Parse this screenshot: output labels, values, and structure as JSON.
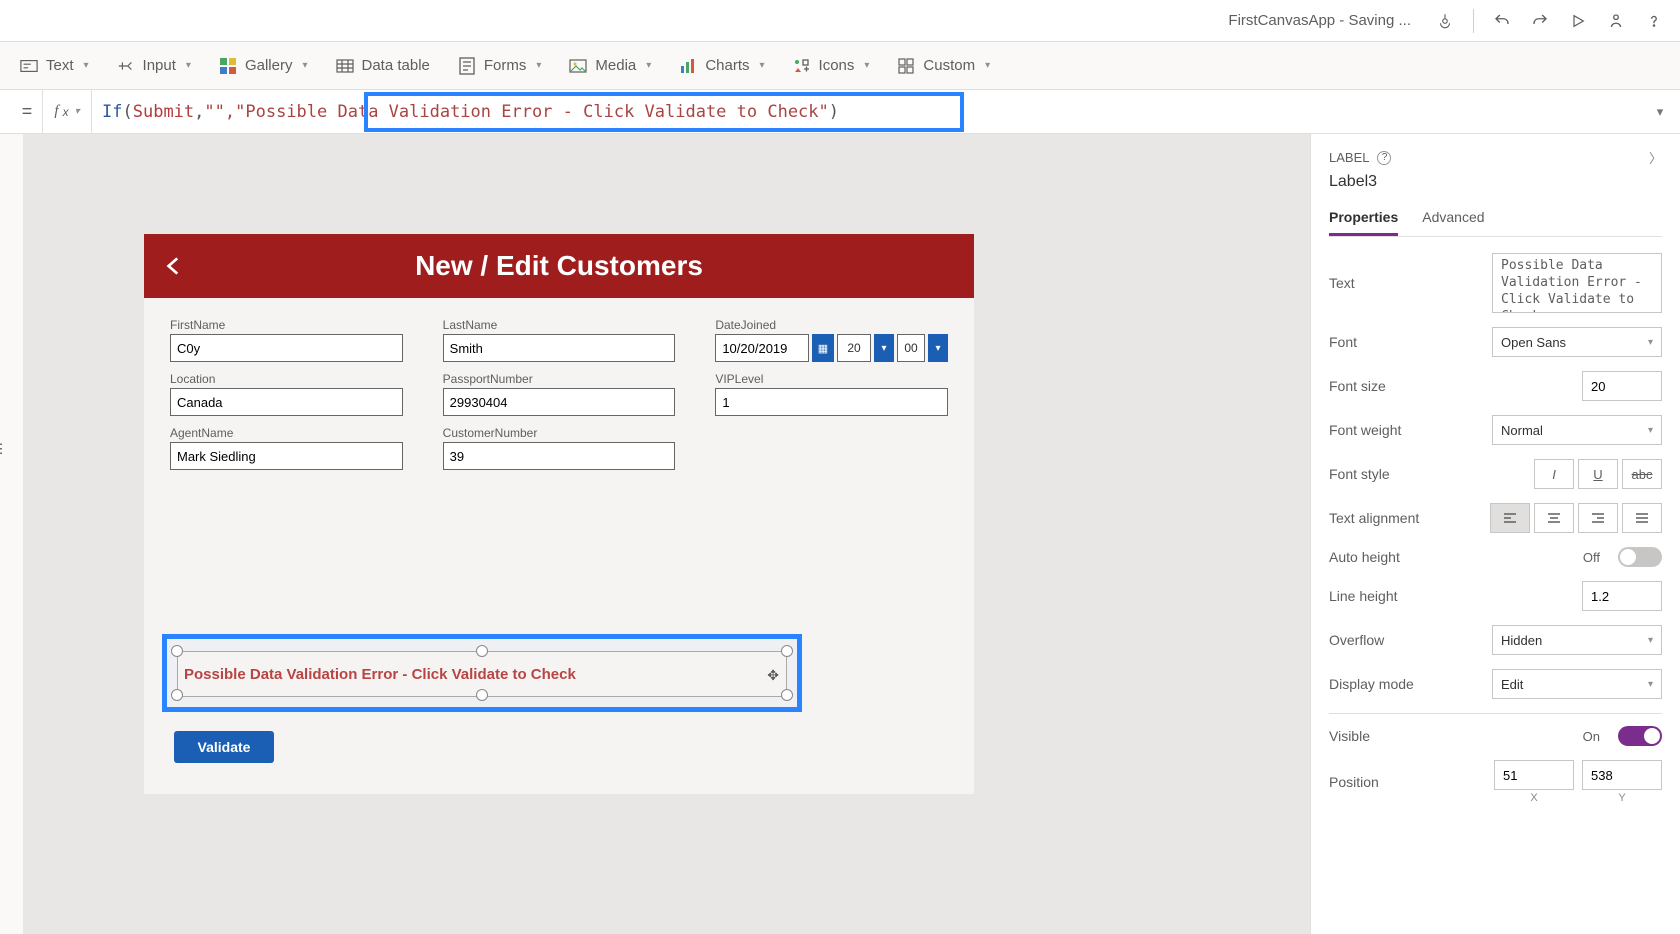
{
  "titlebar": {
    "app_title": "FirstCanvasApp - Saving ..."
  },
  "ribbon": {
    "text": "Text",
    "input": "Input",
    "gallery": "Gallery",
    "data_table": "Data table",
    "forms": "Forms",
    "media": "Media",
    "charts": "Charts",
    "icons": "Icons",
    "custom": "Custom"
  },
  "formula": {
    "fn": "If",
    "arg1": "Submit",
    "arg2": "\"\"",
    "arg3": "\"Possible Data Validation Error - Click Validate to Check\""
  },
  "canvas": {
    "header_title": "New / Edit Customers",
    "fields": {
      "firstname_label": "FirstName",
      "firstname_value": "C0y",
      "lastname_label": "LastName",
      "lastname_value": "Smith",
      "datejoined_label": "DateJoined",
      "datejoined_value": "10/20/2019",
      "datejoined_hour": "20",
      "datejoined_min": "00",
      "location_label": "Location",
      "location_value": "Canada",
      "passport_label": "PassportNumber",
      "passport_value": "29930404",
      "vip_label": "VIPLevel",
      "vip_value": "1",
      "agent_label": "AgentName",
      "agent_value": "Mark Siedling",
      "custnum_label": "CustomerNumber",
      "custnum_value": "39"
    },
    "validation_text": "Possible Data Validation Error - Click Validate to Check",
    "validate_button": "Validate"
  },
  "props": {
    "header_type": "LABEL",
    "control_name": "Label3",
    "tab_properties": "Properties",
    "tab_advanced": "Advanced",
    "text_label": "Text",
    "text_value": "Possible Data Validation Error - Click Validate to Check",
    "font_label": "Font",
    "font_value": "Open Sans",
    "fontsize_label": "Font size",
    "fontsize_value": "20",
    "fontweight_label": "Font weight",
    "fontweight_value": "Normal",
    "fontstyle_label": "Font style",
    "alignment_label": "Text alignment",
    "autoheight_label": "Auto height",
    "autoheight_value": "Off",
    "lineheight_label": "Line height",
    "lineheight_value": "1.2",
    "overflow_label": "Overflow",
    "overflow_value": "Hidden",
    "displaymode_label": "Display mode",
    "displaymode_value": "Edit",
    "visible_label": "Visible",
    "visible_value": "On",
    "position_label": "Position",
    "position_x": "51",
    "position_y": "538",
    "position_x_sub": "X",
    "position_y_sub": "Y"
  }
}
